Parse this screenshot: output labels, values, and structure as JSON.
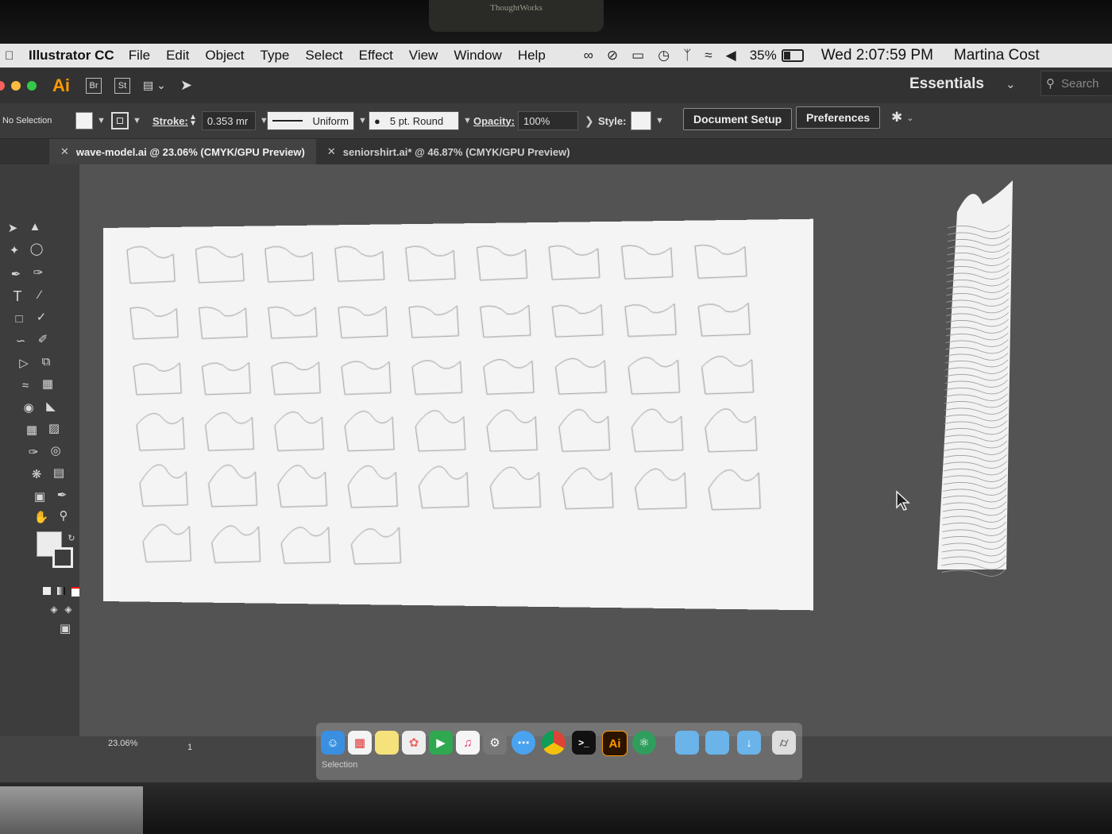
{
  "environment": {
    "camera_brand": "ThoughtWorks"
  },
  "menubar": {
    "app_name": "Illustrator CC",
    "menus": [
      "File",
      "Edit",
      "Object",
      "Type",
      "Select",
      "Effect",
      "View",
      "Window",
      "Help"
    ],
    "battery_percent": "35%",
    "clock": "Wed 2:07:59 PM",
    "user": "Martina Cost"
  },
  "appbar": {
    "logo": "Ai",
    "bridge": "Br",
    "stock": "St",
    "workspace": "Essentials",
    "search_placeholder": "Search"
  },
  "controlbar": {
    "selection": "No Selection",
    "stroke_label": "Stroke:",
    "stroke_weight": "0.353 mr",
    "profile": "Uniform",
    "brush": "5 pt. Round",
    "opacity_label": "Opacity:",
    "opacity_value": "100%",
    "style_label": "Style:",
    "document_setup": "Document Setup",
    "preferences": "Preferences"
  },
  "tabs": [
    {
      "label": "wave-model.ai @ 23.06% (CMYK/GPU Preview)",
      "active": true
    },
    {
      "label": "seniorshirt.ai* @ 46.87% (CMYK/GPU Preview)",
      "active": false
    }
  ],
  "artboard": {
    "rows": [
      9,
      9,
      9,
      9,
      9,
      4
    ],
    "total_slices": 49
  },
  "statusbar": {
    "zoom": "23.06%",
    "page": "1",
    "mode": "Selection"
  },
  "colors": {
    "accent_ai": "#FF9A00",
    "ui_dark": "#323232",
    "canvas": "#535353",
    "artboard": "#F4F4F4"
  }
}
